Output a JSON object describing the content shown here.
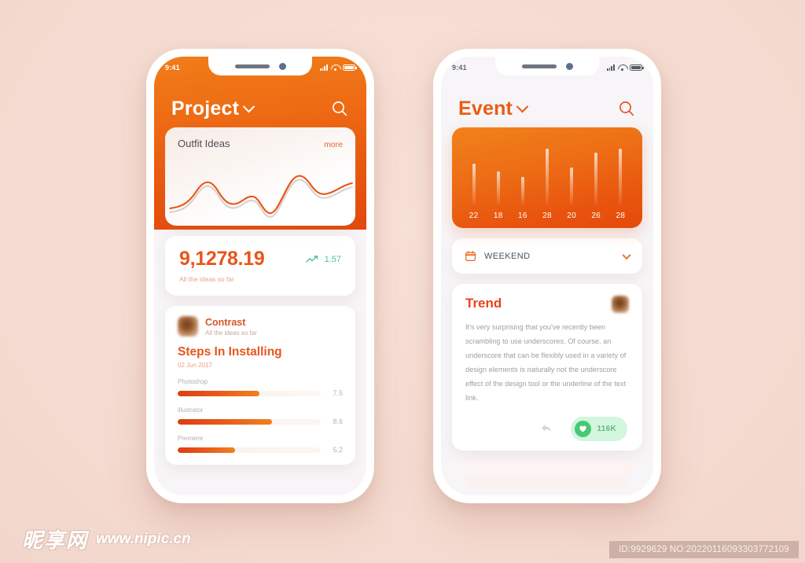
{
  "page": {
    "background_color": "#f5dcd2",
    "accent_orange": "#e8551b",
    "accent_green": "#46c972"
  },
  "left_phone": {
    "status": {
      "time": "9:41",
      "signal_icon": "signal-bars-icon",
      "wifi_icon": "wifi-icon",
      "battery_icon": "battery-icon"
    },
    "appbar": {
      "title": "Project",
      "dropdown_icon": "chevron-down-icon",
      "search_icon": "search-icon"
    },
    "chart_card": {
      "title": "Outfit Ideas",
      "more_label": "more"
    },
    "stat_card": {
      "value": "9,1278.19",
      "subtitle": "All the ideas so far",
      "delta": "1.57",
      "delta_icon": "trend-up-icon"
    },
    "post_card": {
      "avatar": "user-avatar",
      "name": "Contrast",
      "subtitle": "All the ideas so far",
      "title": "Steps In Installing",
      "date": "02 Jun 2017",
      "skills": [
        {
          "label": "Photoshop",
          "value": "7.5",
          "percent": 57
        },
        {
          "label": "illustrator",
          "value": "8.6",
          "percent": 66
        },
        {
          "label": "Premiere",
          "value": "5.2",
          "percent": 40
        }
      ]
    }
  },
  "right_phone": {
    "status": {
      "time": "9:41",
      "signal_icon": "signal-bars-icon",
      "wifi_icon": "wifi-icon",
      "battery_icon": "battery-icon"
    },
    "appbar": {
      "title": "Event",
      "dropdown_icon": "chevron-down-icon",
      "search_icon": "search-icon"
    },
    "select_card": {
      "calendar_icon": "calendar-icon",
      "label": "WEEKEND",
      "chevron_icon": "chevron-down-icon"
    },
    "trend_card": {
      "title": "Trend",
      "avatar": "user-avatar",
      "body": "It's very surprising that you've recently been scrambling to use underscores. Of course, an underscore that can be flexibly used in a variety of design elements is naturally not the underscore effect of the design tool or the underline of the text link.",
      "reply_icon": "reply-arrow-icon",
      "like_icon": "heart-icon",
      "like_count": "116K"
    }
  },
  "chart_data": [
    {
      "type": "bar",
      "title": "Event",
      "categories": [
        "22",
        "18",
        "16",
        "28",
        "20",
        "26",
        "28"
      ],
      "values": [
        22,
        18,
        16,
        28,
        20,
        26,
        28
      ],
      "xlabel": "",
      "ylabel": "",
      "ylim": [
        0,
        30
      ],
      "grid": false,
      "legend": "none"
    },
    {
      "type": "line",
      "title": "Outfit Ideas",
      "x": [
        0,
        1,
        2,
        3,
        4,
        5,
        6,
        7,
        8,
        9,
        10
      ],
      "values": [
        18,
        26,
        58,
        44,
        30,
        40,
        34,
        12,
        62,
        44,
        52
      ],
      "xlabel": "",
      "ylabel": "",
      "ylim": [
        0,
        70
      ],
      "grid": false,
      "legend": "none"
    },
    {
      "type": "bar",
      "title": "Skill ratings",
      "categories": [
        "Photoshop",
        "illustrator",
        "Premiere"
      ],
      "values": [
        7.5,
        8.6,
        5.2
      ],
      "xlabel": "",
      "ylabel": "",
      "ylim": [
        0,
        10
      ],
      "grid": false,
      "legend": "none"
    }
  ],
  "footer": {
    "watermark_cn": "昵享网",
    "watermark_url": "www.nipic.cn",
    "id_text": "ID:9929629 NO:20220116093303772109"
  }
}
